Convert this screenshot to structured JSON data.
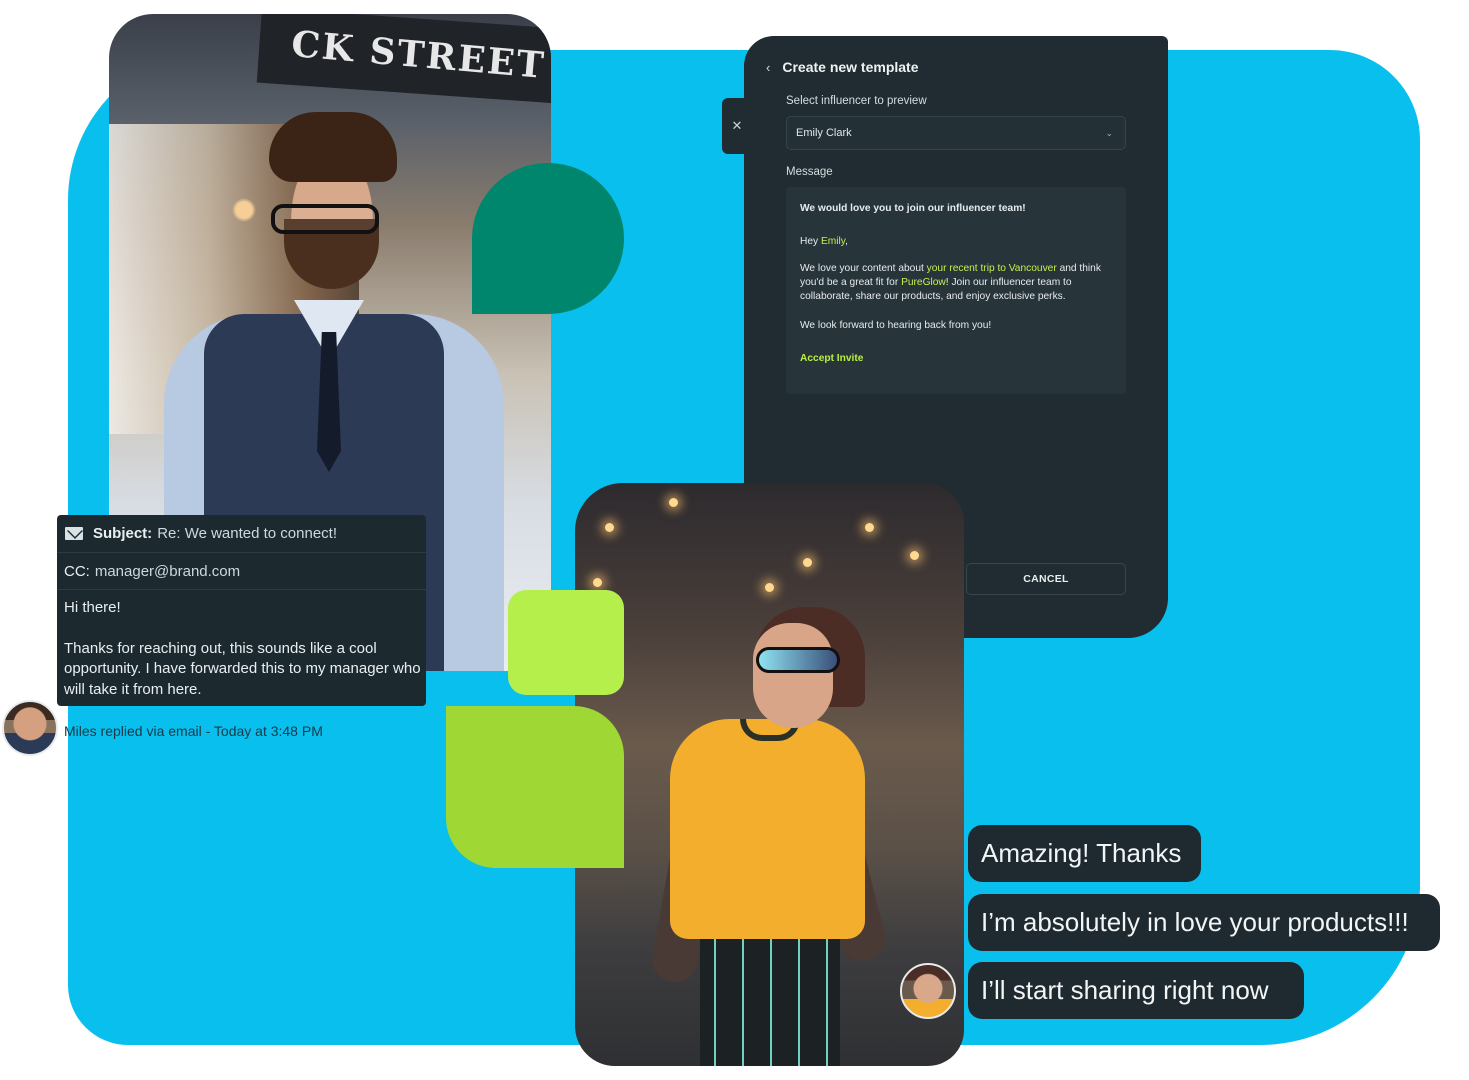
{
  "photo_man": {
    "sign_text": "CK STREET"
  },
  "template_dialog": {
    "title": "Create new template",
    "close_icon": "close-icon",
    "back_icon": "chevron-left-icon",
    "influencer_label": "Select influencer to preview",
    "influencer_value": "Emily Clark",
    "message_label": "Message",
    "message": {
      "subject": "We would love you to join our influencer team!",
      "greeting_prefix": "Hey ",
      "greeting_name": "Emily",
      "greeting_suffix": ",",
      "p1_a": "We love your content about ",
      "p1_highlight": "your recent trip to Vancouver",
      "p1_b": " and think you'd be a great fit for ",
      "p1_brand": "PureGlow",
      "p1_c": "! Join our influencer team to collaborate, share our products, and enjoy exclusive perks.",
      "p2": "We look forward to hearing back from you!",
      "cta": "Accept Invite"
    },
    "cancel_label": "CANCEL"
  },
  "email": {
    "subject_key": "Subject:",
    "subject_value": "Re: We wanted to connect!",
    "cc_key": "CC:",
    "cc_value": "manager@brand.com",
    "greeting": "Hi there!",
    "body": "Thanks for reaching out, this sounds like a cool opportunity. I have forwarded this to my manager who will take it from here.",
    "reply_meta": "Miles replied via email - Today at 3:48 PM"
  },
  "chat": {
    "messages": [
      "Amazing! Thanks",
      "I’m absolutely in love your products!!!",
      "I’ll start sharing right now"
    ]
  },
  "colors": {
    "background_panel": "#08bfee",
    "dark_card": "#202c31",
    "accent_lime": "#b4ef4c",
    "accent_green": "#9fd735",
    "accent_teal": "#00866c",
    "highlight": "#c6f04e"
  }
}
